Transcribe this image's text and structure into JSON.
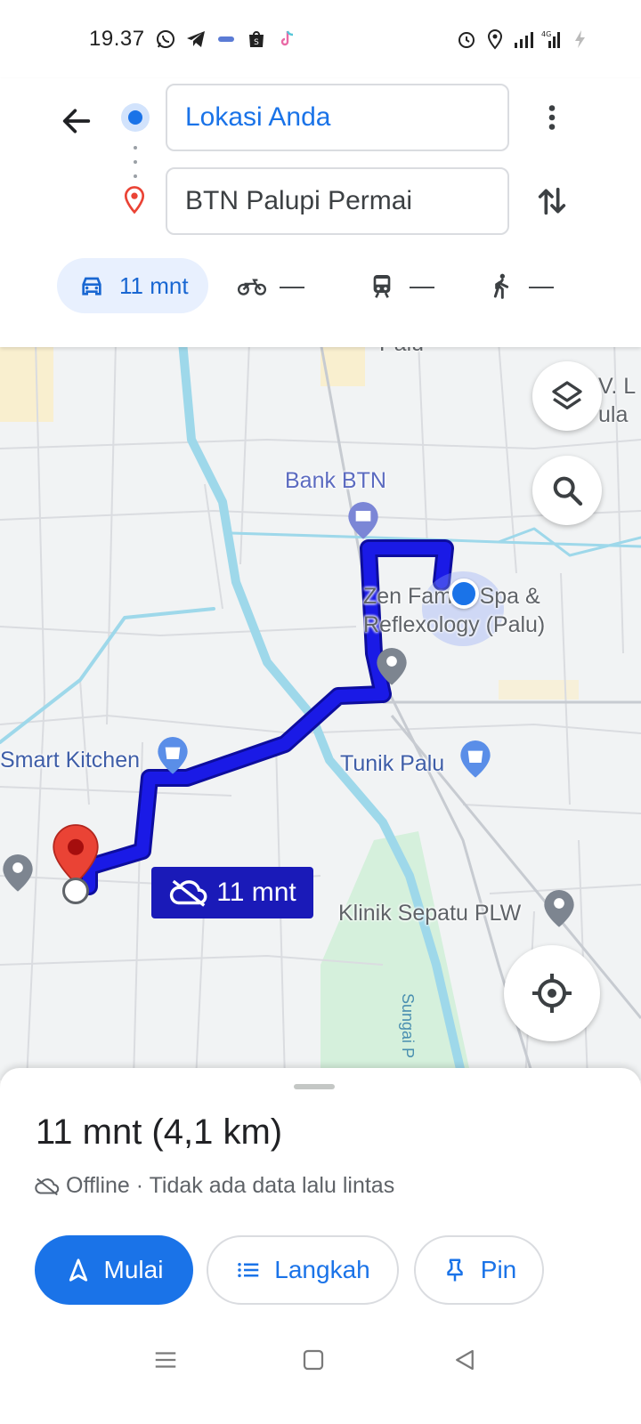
{
  "status_bar": {
    "time": "19.37",
    "left_icons": [
      "whatsapp-icon",
      "telegram-icon",
      "app-icon",
      "shopee-icon",
      "tiktok-icon"
    ],
    "right_icons": [
      "alarm-icon",
      "location-icon",
      "signal-icon",
      "4g-signal-icon",
      "charging-icon"
    ]
  },
  "directions": {
    "origin": "Lokasi Anda",
    "destination": "BTN Palupi Permai",
    "modes": [
      {
        "name": "car",
        "label": "11 mnt",
        "active": true
      },
      {
        "name": "motorcycle",
        "label": "—",
        "active": false
      },
      {
        "name": "transit",
        "label": "—",
        "active": false
      },
      {
        "name": "walk",
        "label": "—",
        "active": false
      }
    ]
  },
  "map": {
    "labels": {
      "palu": "Palu",
      "vl": "V. L",
      "ula": "ula",
      "bank": "Bank BTN",
      "zen1": "Zen Family Spa &",
      "zen2": "Reflexology (Palu)",
      "smart_kitchen": "Smart Kitchen",
      "tunik": "Tunik Palu",
      "klinik": "Klinik Sepatu PLW",
      "sungai": "Sungai P"
    },
    "eta_badge": "11 mnt",
    "route_color": "#1a1ae6"
  },
  "sheet": {
    "summary": "11 mnt (4,1 km)",
    "traffic_status": "Offline · Tidak ada data lalu lintas",
    "buttons": {
      "start": "Mulai",
      "steps": "Langkah",
      "pin": "Pin"
    }
  },
  "colors": {
    "accent": "#1a73e8",
    "route": "#1a1ae6",
    "destination_pin": "#ea4335",
    "water": "#aadaff"
  }
}
